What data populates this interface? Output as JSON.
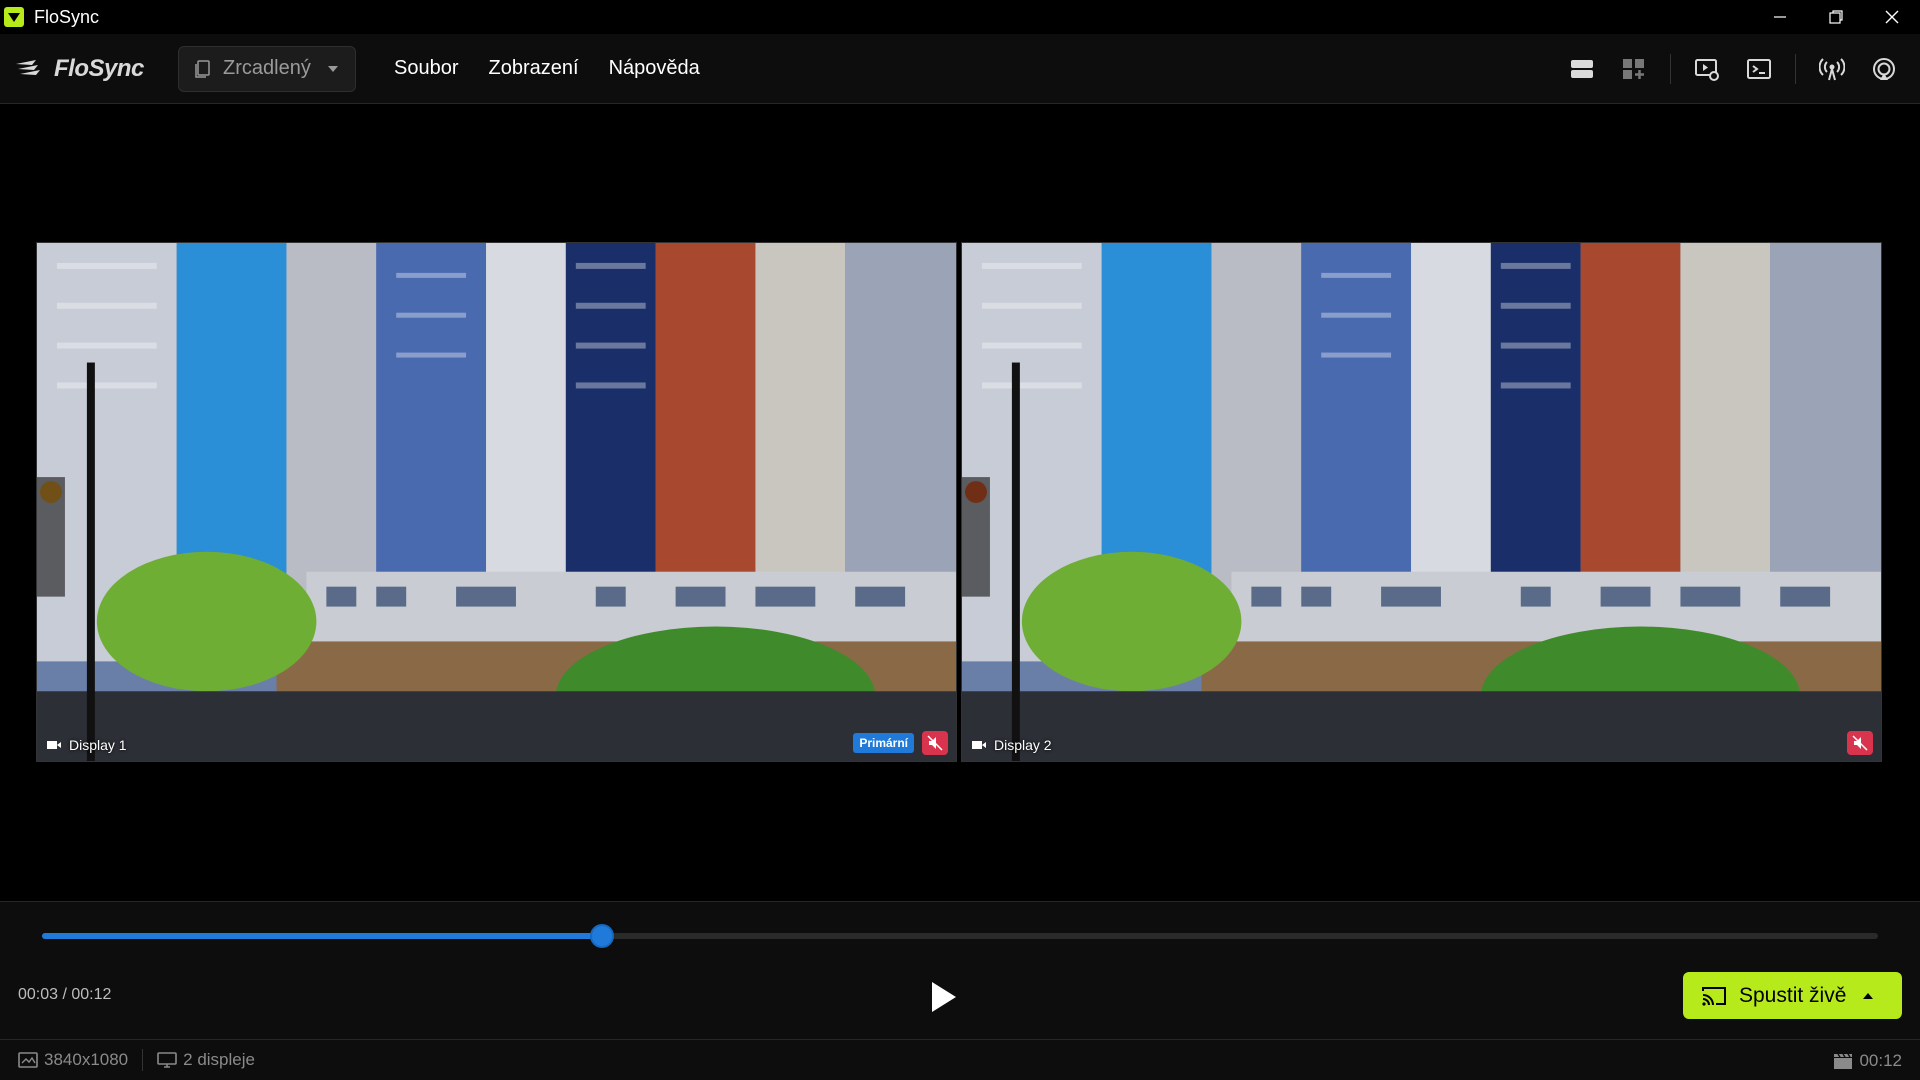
{
  "window": {
    "title": "FloSync"
  },
  "brand": {
    "name": "FloSync"
  },
  "mode": {
    "selected": "Zrcadlený"
  },
  "menu": {
    "items": [
      "Soubor",
      "Zobrazení",
      "Nápověda"
    ]
  },
  "toolbar": {
    "icons": [
      "layout-rows-icon",
      "layout-grid-add-icon",
      "display-settings-icon",
      "terminal-icon",
      "broadcast-icon",
      "airplay-icon"
    ]
  },
  "displays": [
    {
      "label": "Display 1",
      "primary_badge": "Primární",
      "muted": true
    },
    {
      "label": "Display 2",
      "primary_badge": "",
      "muted": true
    }
  ],
  "playback": {
    "time": "00:03 / 00:12",
    "progress": 0.305,
    "go_live_label": "Spustit živě"
  },
  "status": {
    "resolution": "3840x1080",
    "displays_count": "2 displeje",
    "duration": "00:12"
  },
  "colors": {
    "accent": "#1f7ad9",
    "go_live": "#b6ea1a",
    "mute": "#d9344e",
    "brand_icon": "#b6ea1a"
  }
}
